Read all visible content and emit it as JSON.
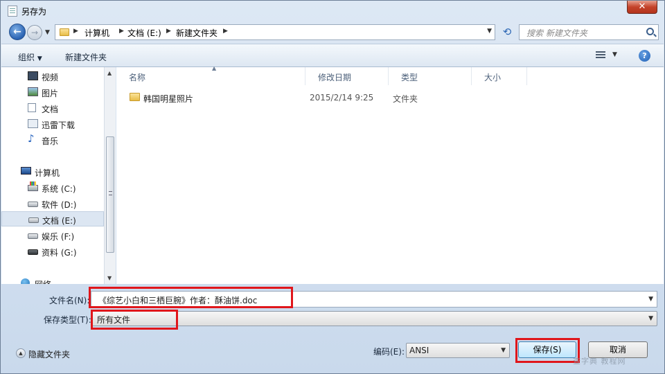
{
  "window": {
    "title": "另存为",
    "close_glyph": "✕"
  },
  "address": {
    "back_glyph": "←",
    "forward_glyph": "→",
    "breadcrumbs": [
      "计算机",
      "文档 (E:)",
      "新建文件夹"
    ],
    "search_placeholder": "搜索 新建文件夹",
    "refresh_glyph": "⟲"
  },
  "toolbar": {
    "organize_label": "组织",
    "new_folder_label": "新建文件夹",
    "help_glyph": "?"
  },
  "nav": {
    "items": [
      {
        "label": "视频",
        "icon": "video-icon"
      },
      {
        "label": "图片",
        "icon": "picture-icon"
      },
      {
        "label": "文档",
        "icon": "document-icon"
      },
      {
        "label": "迅雷下载",
        "icon": "download-folder-icon"
      },
      {
        "label": "音乐",
        "icon": "music-icon"
      },
      {
        "label": "计算机",
        "icon": "computer-icon"
      },
      {
        "label": "系统 (C:)",
        "icon": "system-drive-icon"
      },
      {
        "label": "软件 (D:)",
        "icon": "drive-icon"
      },
      {
        "label": "文档 (E:)",
        "icon": "drive-icon",
        "selected": true
      },
      {
        "label": "娱乐 (F:)",
        "icon": "drive-icon"
      },
      {
        "label": "资料 (G:)",
        "icon": "drive-icon"
      },
      {
        "label": "网络",
        "icon": "network-icon"
      }
    ]
  },
  "filelist": {
    "columns": [
      "名称",
      "修改日期",
      "类型",
      "大小"
    ],
    "rows": [
      {
        "name": "韩国明星照片",
        "modified": "2015/2/14 9:25",
        "type": "文件夹",
        "size": ""
      }
    ]
  },
  "form": {
    "filename_label": "文件名(N):",
    "filename_value": "《综艺小白和三栖巨腕》作者：酥油饼.doc",
    "filetype_label": "保存类型(T):",
    "filetype_value": "所有文件",
    "encoding_label": "编码(E):",
    "encoding_value": "ANSI",
    "hide_folders_label": "隐藏文件夹",
    "save_label": "保存(S)",
    "cancel_label": "取消"
  },
  "watermark": "查字典 教程网",
  "colors": {
    "highlight": "#e0161b",
    "window_bg": "#cfdbe9"
  }
}
